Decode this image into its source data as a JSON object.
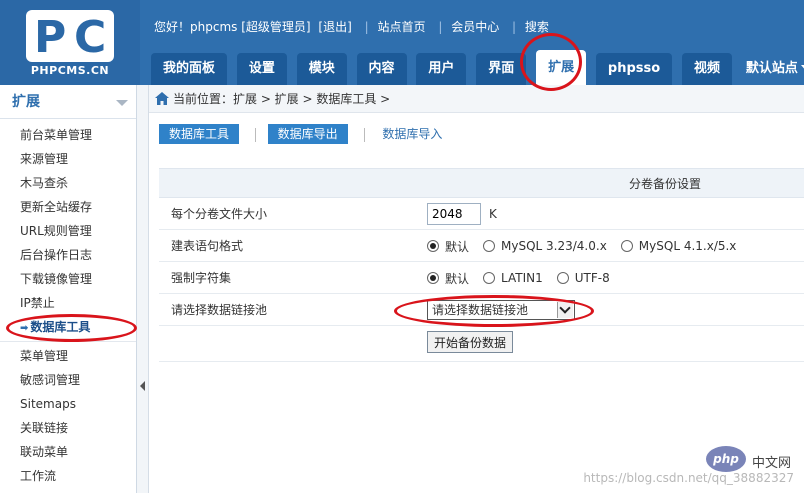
{
  "logo": {
    "text": "PHPCMS.CN"
  },
  "topbar": {
    "greeting": "您好！phpcms [超级管理员]",
    "logout": "[退出]",
    "home": "站点首页",
    "member": "会员中心",
    "search": "搜索"
  },
  "nav": {
    "tabs": [
      "我的面板",
      "设置",
      "模块",
      "内容",
      "用户",
      "界面",
      "扩展",
      "phpsso",
      "视频"
    ],
    "active": "扩展",
    "site_select": "默认站点"
  },
  "sidebar": {
    "title": "扩展",
    "items": [
      "前台菜单管理",
      "来源管理",
      "木马查杀",
      "更新全站缓存",
      "URL规则管理",
      "后台操作日志",
      "下载镜像管理",
      "IP禁止",
      "数据库工具",
      "菜单管理",
      "敏感词管理",
      "Sitemaps",
      "关联链接",
      "联动菜单",
      "工作流"
    ]
  },
  "breadcrumb": "当前位置：扩展 > 扩展 > 数据库工具 >",
  "subtabs": [
    "数据库工具",
    "数据库导出",
    "数据库导入"
  ],
  "form": {
    "header": "分卷备份设置",
    "size_label": "每个分卷文件大小",
    "size_value": "2048",
    "size_unit": "K",
    "format_label": "建表语句格式",
    "format_options": [
      "默认",
      "MySQL 3.23/4.0.x",
      "MySQL 4.1.x/5.x"
    ],
    "charset_label": "强制字符集",
    "charset_options": [
      "默认",
      "LATIN1",
      "UTF-8"
    ],
    "pool_label": "请选择数据链接池",
    "pool_value": "请选择数据链接池",
    "submit": "开始备份数据"
  },
  "watermark": "https://blog.csdn.net/qq_38882327",
  "php_badge": {
    "logo": "php",
    "site": "中文网"
  },
  "colors": {
    "header": "#2f6fae",
    "accent": "#2f82c9",
    "annotation": "#d9141b"
  }
}
